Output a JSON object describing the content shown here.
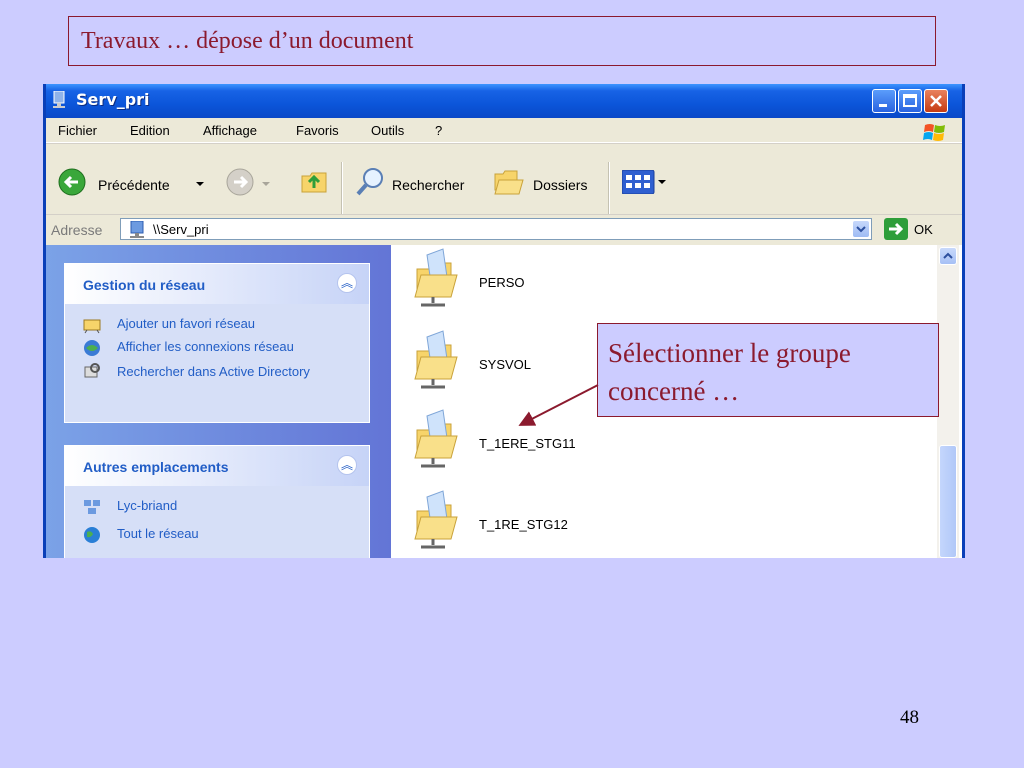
{
  "slide": {
    "title": "Travaux … dépose d’un document",
    "callout": "Sélectionner le groupe concerné …",
    "page_number": "48"
  },
  "window": {
    "title": "Serv_pri",
    "menu": [
      "Fichier",
      "Edition",
      "Affichage",
      "Favoris",
      "Outils",
      "?"
    ],
    "toolbar": {
      "back_label": "Précédente",
      "search_label": "Rechercher",
      "folders_label": "Dossiers"
    },
    "address": {
      "label": "Adresse",
      "value": "\\\\Serv_pri",
      "go_label": "OK"
    }
  },
  "taskpane": {
    "network_tasks": {
      "title": "Gestion du réseau",
      "items": [
        "Ajouter un favori réseau",
        "Afficher les connexions réseau",
        "Rechercher dans Active Directory"
      ]
    },
    "other_places": {
      "title": "Autres emplacements",
      "items": [
        "Lyc-briand",
        "Tout le réseau"
      ]
    }
  },
  "shares": [
    "PERSO",
    "SYSVOL",
    "T_1ERE_STG11",
    "T_1RE_STG12"
  ],
  "colors": {
    "slide_bg": "#ccccff",
    "accent": "#8b1a2e",
    "xp_blue": "#0a49c8",
    "task_link": "#215dc6"
  }
}
